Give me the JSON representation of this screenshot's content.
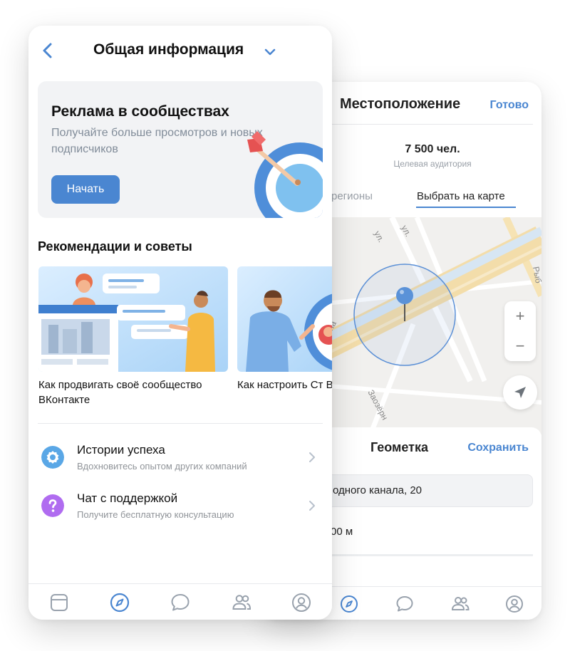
{
  "location_screen": {
    "title": "Местоположение",
    "done_label": "Готово",
    "audience_count": "7 500 чел.",
    "audience_label": "Целевая аудитория",
    "tab_regions": "регионы",
    "tab_map": "Выбрать на карте",
    "map": {
      "street_labels": [
        "ул.",
        "ул.",
        "Рыб",
        "на",
        "Заозёрн"
      ],
      "zoom_in": "+",
      "zoom_out": "−"
    },
    "geotag": {
      "title": "Геометка",
      "save_label": "Сохранить",
      "address": "одного канала, 20",
      "radius": "00 м"
    }
  },
  "main_screen": {
    "title": "Общая информация",
    "promo": {
      "title": "Реклама в сообществах",
      "description": "Получайте больше просмотров и новых подписчиков",
      "button_label": "Начать"
    },
    "recommendations_title": "Рекомендации и советы",
    "cards": [
      {
        "caption": "Как продвигать своё сообщество ВКонтакте"
      },
      {
        "caption": "Как настроить Ст ВКонтакте?"
      }
    ],
    "list": [
      {
        "title": "Истории успеха",
        "subtitle": "Вдохновитесь опытом других компаний",
        "icon": "award-icon"
      },
      {
        "title": "Чат с поддержкой",
        "subtitle": "Получите бесплатную консультацию",
        "icon": "question-icon"
      }
    ],
    "tabbar": [
      "newsfeed-icon",
      "explore-icon",
      "messages-icon",
      "friends-icon",
      "profile-icon"
    ]
  },
  "colors": {
    "accent": "#4a86d1",
    "secondary_text": "#818c99",
    "award": "#5aa7e6",
    "question": "#b06cf0"
  }
}
